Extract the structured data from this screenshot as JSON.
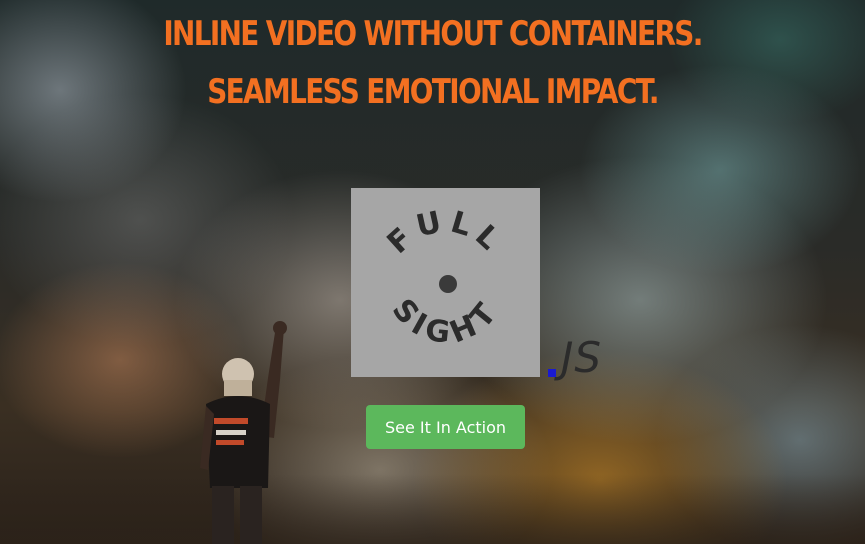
{
  "hero": {
    "headline_line1": "INLINE VIDEO WITHOUT CONTAINERS.",
    "headline_line2": "SEAMLESS EMOTIONAL IMPACT."
  },
  "logo": {
    "word_top": "FULL",
    "word_bottom": "SIGHT",
    "suffix": "JS"
  },
  "cta": {
    "label": "See It In Action"
  },
  "colors": {
    "headline": "#f37021",
    "button": "#5cb85c",
    "logo_box": "#a6a6a6",
    "js_dot": "#1a1ad0"
  }
}
